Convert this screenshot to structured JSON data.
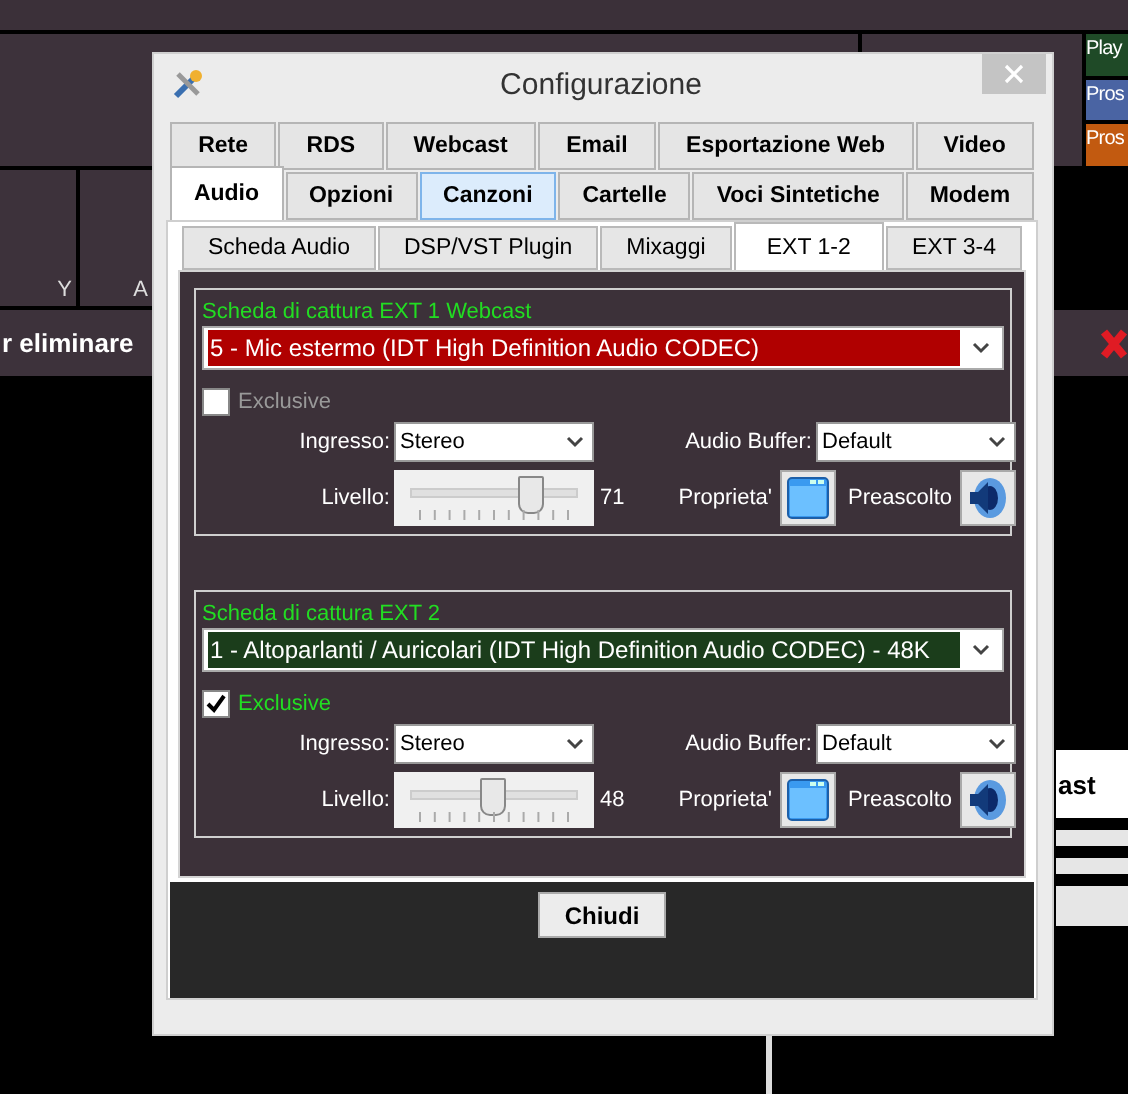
{
  "background": {
    "header_labels": [
      "Y",
      "A"
    ],
    "banner": "r eliminare",
    "tiles": [
      {
        "label": "Play",
        "color": "#1f4a27"
      },
      {
        "label": "Pros",
        "color": "#4a64a3"
      },
      {
        "label": "Pros",
        "color": "#c25a10"
      }
    ],
    "side_panel_text": "ast"
  },
  "dialog": {
    "title": "Configurazione",
    "tab_rows": [
      [
        {
          "label": "Rete",
          "selected": false,
          "highlighted": false
        },
        {
          "label": "RDS",
          "selected": false,
          "highlighted": false
        },
        {
          "label": "Webcast",
          "selected": false,
          "highlighted": false
        },
        {
          "label": "Email",
          "selected": false,
          "highlighted": false
        },
        {
          "label": "Esportazione Web",
          "selected": false,
          "highlighted": false
        },
        {
          "label": "Video",
          "selected": false,
          "highlighted": false
        }
      ],
      [
        {
          "label": "Audio",
          "selected": true,
          "highlighted": false
        },
        {
          "label": "Opzioni",
          "selected": false,
          "highlighted": false
        },
        {
          "label": "Canzoni",
          "selected": false,
          "highlighted": true
        },
        {
          "label": "Cartelle",
          "selected": false,
          "highlighted": false
        },
        {
          "label": "Voci Sintetiche",
          "selected": false,
          "highlighted": false
        },
        {
          "label": "Modem",
          "selected": false,
          "highlighted": false
        }
      ]
    ],
    "subtabs": [
      {
        "label": "Scheda Audio",
        "selected": false
      },
      {
        "label": "DSP/VST Plugin",
        "selected": false
      },
      {
        "label": "Mixaggi",
        "selected": false
      },
      {
        "label": "EXT 1-2",
        "selected": true
      },
      {
        "label": "EXT 3-4",
        "selected": false
      }
    ],
    "groups": [
      {
        "title": "Scheda di cattura EXT 1 Webcast",
        "device": "5 - Mic estermo (IDT High Definition Audio CODEC)",
        "color": "#b00000",
        "exclusive": {
          "label": "Exclusive",
          "checked": false
        },
        "input_label": "Ingresso:",
        "input_value": "Stereo",
        "buffer_label": "Audio Buffer:",
        "buffer_value": "Default",
        "level_label": "Livello:",
        "level": 0.71,
        "reading": "71",
        "properties_label": "Proprieta'",
        "preview_label": "Preascolto"
      },
      {
        "title": "Scheda di cattura EXT 2",
        "device": "1 - Altoparlanti / Auricolari (IDT High Definition Audio CODEC) - 48K",
        "color": "#1b3d1b",
        "exclusive": {
          "label": "Exclusive",
          "checked": true
        },
        "input_label": "Ingresso:",
        "input_value": "Stereo",
        "buffer_label": "Audio Buffer:",
        "buffer_value": "Default",
        "level_label": "Livello:",
        "level": 0.48,
        "reading": "48",
        "properties_label": "Proprieta'",
        "preview_label": "Preascolto"
      }
    ],
    "close_button": "Chiudi"
  }
}
